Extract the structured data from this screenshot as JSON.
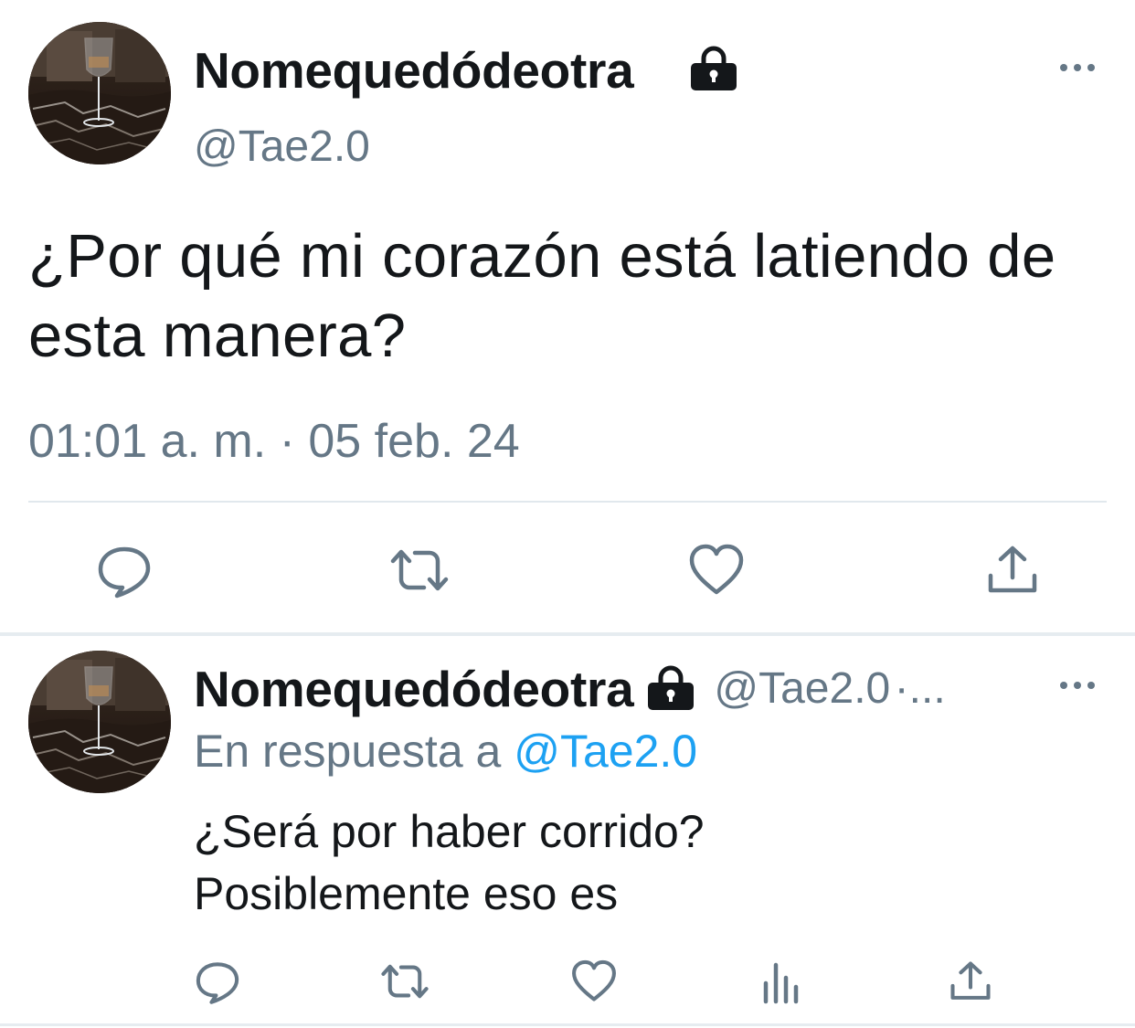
{
  "main_tweet": {
    "display_name": "Nomequedódeotra",
    "handle": "@Tae2.0",
    "text": "¿Por qué mi corazón está latiendo de esta manera?",
    "timestamp": "01:01 a. m. · 05 feb. 24",
    "icons": {
      "lock": "lock-icon",
      "more": "more-options-icon",
      "reply": "reply-icon",
      "retweet": "retweet-icon",
      "like": "heart-icon",
      "share": "share-icon"
    }
  },
  "reply_tweet": {
    "display_name": "Nomequedódeotra",
    "handle": "@Tae2.0",
    "handle_ellipsis": "·...",
    "replying_to_prefix": "En respuesta a",
    "replying_to_handle": "@Tae2.0",
    "text": "¿Será por haber corrido?\nPosiblemente eso es",
    "icons": {
      "lock": "lock-icon",
      "more": "more-options-icon",
      "reply": "reply-icon",
      "retweet": "retweet-icon",
      "like": "heart-icon",
      "analytics": "analytics-icon",
      "share": "share-icon"
    }
  },
  "colors": {
    "text_primary": "#14171a",
    "text_secondary": "#657786",
    "link": "#1da1f2",
    "divider": "#e1e8ed"
  }
}
